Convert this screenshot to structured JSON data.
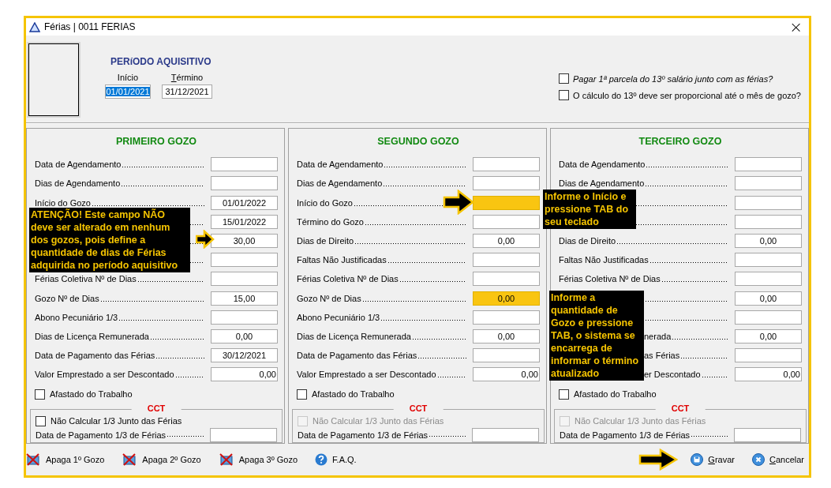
{
  "window": {
    "title": "Férias | 0011 FERIAS",
    "close": "×"
  },
  "periodo": {
    "title": "PERíODO AQUISITIVO",
    "start": {
      "label": "Início",
      "value": "01/01/2021",
      "selected": true
    },
    "end": {
      "label": "Término",
      "value": "31/12/2021",
      "selected": false
    }
  },
  "options": [
    {
      "label": "Pagar 1ª parcela do 13º salário junto com as férias?",
      "checked": false,
      "italic": true
    },
    {
      "label": "O cálculo do 13º deve ser proporcional até o mês de gozo?",
      "checked": false,
      "italic": false
    }
  ],
  "panels": [
    {
      "title": "PRIMEIRO GOZO",
      "fields": [
        {
          "label": "Data de Agendamento",
          "kind": "plain",
          "highlighted": false,
          "partial": false
        },
        {
          "label": "Dias de Agendamento",
          "kind": "plain",
          "highlighted": false,
          "partial": false
        },
        {
          "label": "Início do Gozo",
          "value": "01/01/2022",
          "kind": "plain",
          "highlighted": false,
          "partial": false
        },
        {
          "value": "15/01/2022",
          "kind": "plain",
          "highlighted": false
        },
        {
          "value": "30,00",
          "kind": "plain",
          "highlighted": false
        },
        {
          "kind": "plain",
          "highlighted": false
        },
        {
          "label": "Férias Coletiva Nº de Dias",
          "kind": "plain",
          "highlighted": false,
          "partial": false
        },
        {
          "label": "Gozo Nº de Dias",
          "value": "15,00",
          "kind": "plain",
          "highlighted": false,
          "partial": false
        },
        {
          "label": "Abono Pecuniário 1/3",
          "kind": "plain",
          "highlighted": false,
          "partial": false
        },
        {
          "label": "Dias de Licença Remunerada",
          "value": "0,00",
          "kind": "plain",
          "highlighted": false,
          "partial": false
        },
        {
          "label": "Data de Pagamento das Férias",
          "value": "30/12/2021",
          "kind": "plain",
          "highlighted": false,
          "partial": false
        },
        {
          "label": "Valor Emprestado a ser Descontado",
          "value": "0,00",
          "kind": "amount",
          "highlighted": false,
          "partial": false
        }
      ],
      "afastado": {
        "label": "Afastado do Trabalho",
        "checked": false
      },
      "cct": {
        "title": "CCT",
        "checkbox": {
          "label": "Não Calcular 1/3 Junto das Férias",
          "checked": false,
          "disabled": false
        },
        "field": {
          "label": "Data de Pagamento 1/3 de Férias"
        }
      }
    },
    {
      "title": "SEGUNDO GOZO",
      "fields": [
        {
          "label": "Data de Agendamento",
          "kind": "plain",
          "highlighted": false,
          "partial": false
        },
        {
          "label": "Dias de Agendamento",
          "kind": "plain",
          "highlighted": false,
          "partial": false
        },
        {
          "label": "Início do Gozo",
          "kind": "plain",
          "highlighted": true,
          "partial": false
        },
        {
          "label": "Término do Gozo",
          "kind": "plain",
          "highlighted": false,
          "partial": false
        },
        {
          "label": "Dias de Direito",
          "value": "0,00",
          "kind": "plain",
          "highlighted": false,
          "partial": false
        },
        {
          "label": "Faltas Não Justificadas",
          "kind": "plain",
          "highlighted": false,
          "partial": false
        },
        {
          "label": "Férias Coletiva Nº de Dias",
          "kind": "plain",
          "highlighted": false,
          "partial": false
        },
        {
          "label": "Gozo Nº de Dias",
          "value": "0,00",
          "kind": "plain",
          "highlighted": true,
          "partial": false
        },
        {
          "label": "Abono Pecuniário 1/3",
          "kind": "plain",
          "highlighted": false,
          "partial": false
        },
        {
          "label": "Dias de Licença Remunerada",
          "value": "0,00",
          "kind": "plain",
          "highlighted": false,
          "partial": false
        },
        {
          "label": "Data de Pagamento das Férias",
          "kind": "plain",
          "highlighted": false,
          "partial": false
        },
        {
          "label": "Valor Emprestado a ser Descontado",
          "value": "0,00",
          "kind": "amount",
          "highlighted": false,
          "partial": false
        }
      ],
      "afastado": {
        "label": "Afastado do Trabalho",
        "checked": false
      },
      "cct": {
        "title": "CCT",
        "checkbox": {
          "label": "Não Calcular 1/3 Junto das Férias",
          "checked": false,
          "disabled": true
        },
        "field": {
          "label": "Data de Pagamento 1/3 de Férias"
        }
      }
    },
    {
      "title": "TERCEIRO GOZO",
      "fields": [
        {
          "label": "Data de Agendamento",
          "kind": "plain",
          "highlighted": false,
          "partial": false
        },
        {
          "label": "Dias de Agendamento",
          "kind": "plain",
          "highlighted": false,
          "partial": false
        },
        {
          "kind": "plain",
          "highlighted": false
        },
        {
          "kind": "plain",
          "highlighted": false
        },
        {
          "label": "Dias de Direito",
          "value": "0,00",
          "kind": "plain",
          "highlighted": false,
          "partial": false
        },
        {
          "label": "Faltas Não Justificadas",
          "kind": "plain",
          "highlighted": false,
          "partial": false
        },
        {
          "label": "Férias Coletiva Nº de Dias",
          "kind": "plain",
          "highlighted": false,
          "partial": false
        },
        {
          "value": "0,00",
          "kind": "plain",
          "highlighted": false
        },
        {
          "kind": "plain",
          "highlighted": false
        },
        {
          "label": "nerada",
          "value": "0,00",
          "kind": "plain",
          "highlighted": false,
          "partial": true
        },
        {
          "label": "as Férias",
          "kind": "plain",
          "highlighted": false,
          "partial": true
        },
        {
          "label": "er Descontado",
          "value": "0,00",
          "kind": "amount",
          "highlighted": false,
          "partial": true
        }
      ],
      "afastado": {
        "label": "Afastado do Trabalho",
        "checked": false
      },
      "cct": {
        "title": "CCT",
        "checkbox": {
          "label": "Não Calcular 1/3 Junto das Férias",
          "checked": false,
          "disabled": true
        },
        "field": {
          "label": "Data de Pagamento 1/3 de Férias"
        }
      }
    }
  ],
  "callouts": [
    {
      "text": "ATENÇÃO! Este campo NÃO\ndeve ser alterado em nenhum\ndos gozos, pois define a\nquantidade de dias de Férias\nadquirida no período aquisitivo"
    },
    {
      "text": "Informe o Início e\npressione TAB do\nseu teclado"
    },
    {
      "text": "Informe a\nquantidade de\nGozo e pressione\nTAB, o sistema se\nencarrega de\ninformar o término\natualizado"
    }
  ],
  "actions_left": [
    {
      "label": "Apaga 1º Gozo",
      "kind": "delete"
    },
    {
      "label": "Apaga 2º Gozo",
      "kind": "delete"
    },
    {
      "label": "Apaga 3º Gozo",
      "kind": "delete"
    },
    {
      "label": "F.A.Q.",
      "kind": "help"
    }
  ],
  "actions_right": [
    {
      "label": "Gravar",
      "kind": "save"
    },
    {
      "label": "Cancelar",
      "kind": "cancel"
    }
  ]
}
